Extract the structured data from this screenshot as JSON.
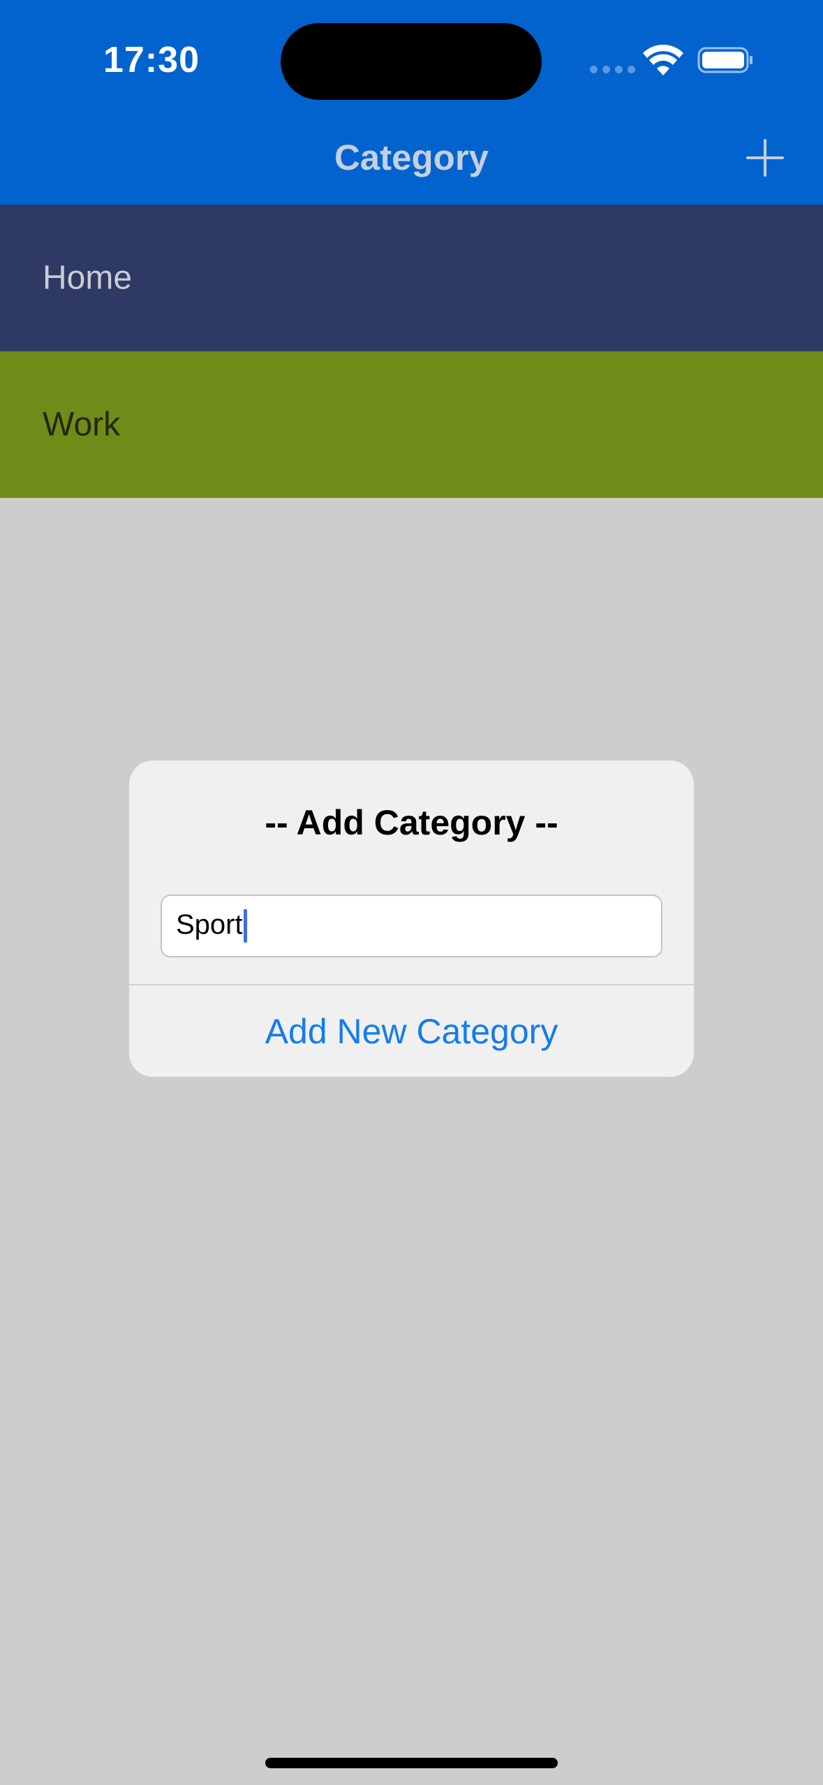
{
  "status_bar": {
    "time": "17:30"
  },
  "nav": {
    "title": "Category",
    "add_icon": "plus-icon"
  },
  "categories": [
    {
      "name": "Home",
      "color": "#2E3A64"
    },
    {
      "name": "Work",
      "color": "#718B19"
    }
  ],
  "alert": {
    "title": "-- Add Category --",
    "input_value": "Sport",
    "action_label": "Add New Category"
  },
  "colors": {
    "nav_background": "#0263CF",
    "accent": "#157CEB",
    "overlay": "#CDCDCD"
  }
}
